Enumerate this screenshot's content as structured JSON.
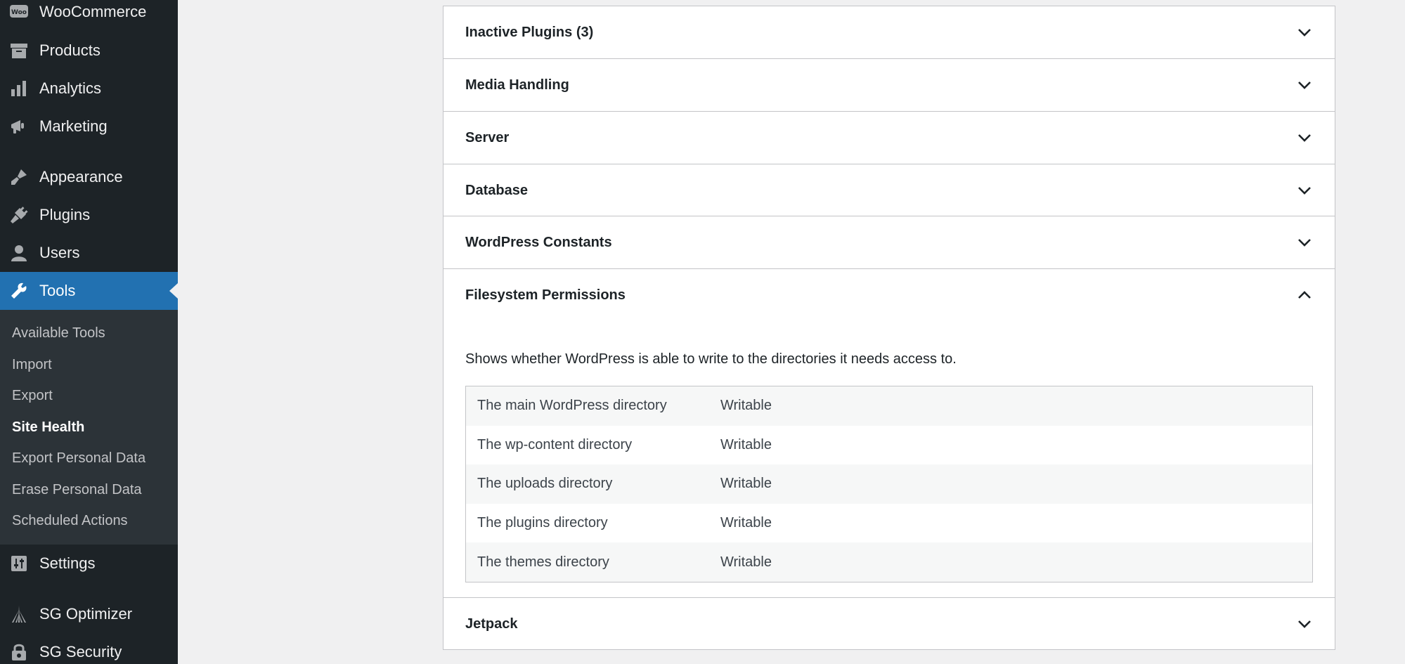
{
  "sidebar": {
    "items": [
      {
        "label": "WooCommerce",
        "icon": "woo-icon"
      },
      {
        "label": "Products",
        "icon": "archive-icon"
      },
      {
        "label": "Analytics",
        "icon": "bar-chart-icon"
      },
      {
        "label": "Marketing",
        "icon": "megaphone-icon"
      },
      {
        "label": "Appearance",
        "icon": "paintbrush-icon"
      },
      {
        "label": "Plugins",
        "icon": "plug-icon"
      },
      {
        "label": "Users",
        "icon": "user-icon"
      },
      {
        "label": "Tools",
        "icon": "wrench-icon",
        "active": true
      },
      {
        "label": "Settings",
        "icon": "sliders-icon"
      },
      {
        "label": "SG Optimizer",
        "icon": "sg-optimizer-icon"
      },
      {
        "label": "SG Security",
        "icon": "lock-gear-icon"
      }
    ],
    "submenu": [
      "Available Tools",
      "Import",
      "Export",
      "Site Health",
      "Export Personal Data",
      "Erase Personal Data",
      "Scheduled Actions"
    ],
    "current_submenu": "Site Health"
  },
  "sections": [
    {
      "title": "Inactive Plugins (3)",
      "expanded": false
    },
    {
      "title": "Media Handling",
      "expanded": false
    },
    {
      "title": "Server",
      "expanded": false
    },
    {
      "title": "Database",
      "expanded": false
    },
    {
      "title": "WordPress Constants",
      "expanded": false
    },
    {
      "title": "Filesystem Permissions",
      "expanded": true,
      "description": "Shows whether WordPress is able to write to the directories it needs access to.",
      "rows": [
        {
          "key": "The main WordPress directory",
          "value": "Writable"
        },
        {
          "key": "The wp-content directory",
          "value": "Writable"
        },
        {
          "key": "The uploads directory",
          "value": "Writable"
        },
        {
          "key": "The plugins directory",
          "value": "Writable"
        },
        {
          "key": "The themes directory",
          "value": "Writable"
        }
      ]
    },
    {
      "title": "Jetpack",
      "expanded": false
    }
  ],
  "colors": {
    "sidebar_bg": "#1d2327",
    "submenu_bg": "#2c3338",
    "active_bg": "#2271b1",
    "page_bg": "#f0f0f1"
  }
}
